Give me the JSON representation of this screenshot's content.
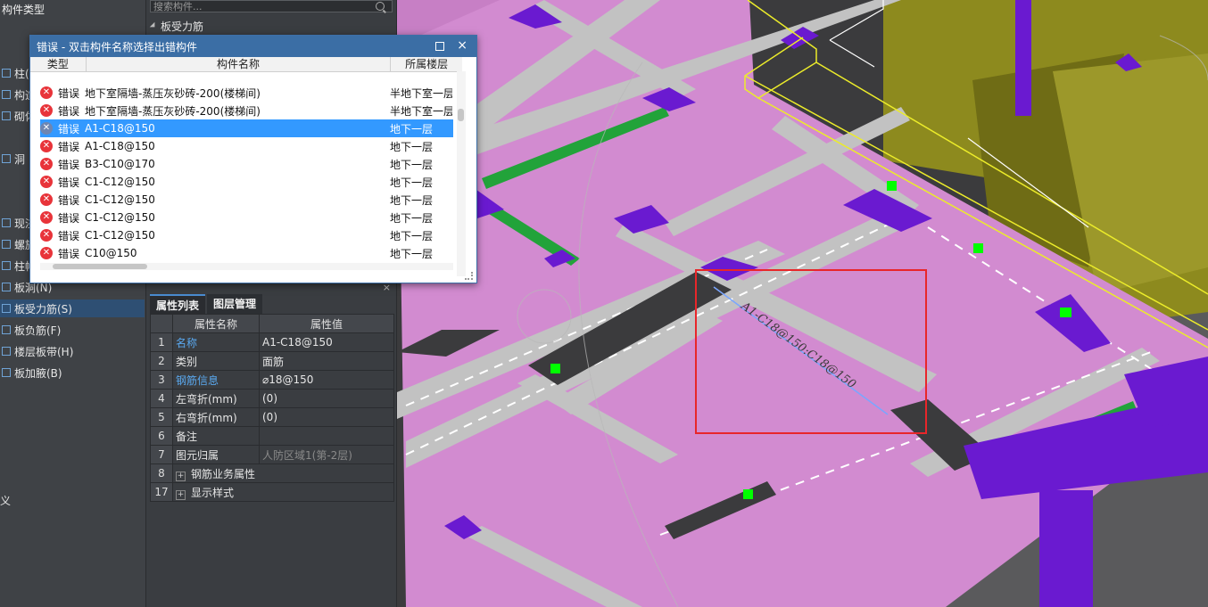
{
  "left_panel": {
    "title": "构件类型",
    "items": [
      {
        "label": "柱(",
        "selected": false
      },
      {
        "label": "构造",
        "selected": false
      },
      {
        "label": "砌体",
        "selected": false
      },
      {
        "label": "洞",
        "selected": false
      },
      {
        "label": "现浇",
        "selected": false
      },
      {
        "label": "螺旋",
        "selected": false
      },
      {
        "label": "柱帽",
        "selected": false
      },
      {
        "label": "板洞(N)",
        "selected": false
      },
      {
        "label": "板受力筋(S)",
        "selected": true
      },
      {
        "label": "板负筋(F)",
        "selected": false
      },
      {
        "label": "楼层板带(H)",
        "selected": false
      },
      {
        "label": "板加腋(B)",
        "selected": false
      }
    ],
    "bottom_char": "义"
  },
  "middle": {
    "search_placeholder": "搜索构件...",
    "tree_node": "板受力筋"
  },
  "properties": {
    "tabs": [
      "属性列表",
      "图层管理"
    ],
    "close": "×",
    "headers": [
      "属性名称",
      "属性值"
    ],
    "rows": [
      {
        "num": "1",
        "name": "名称",
        "value": "A1-C18@150",
        "link": true,
        "gray": false,
        "expand": false
      },
      {
        "num": "2",
        "name": "类别",
        "value": "面筋",
        "link": false,
        "gray": false,
        "expand": false
      },
      {
        "num": "3",
        "name": "钢筋信息",
        "value": "⌀18@150",
        "link": true,
        "gray": false,
        "expand": false
      },
      {
        "num": "4",
        "name": "左弯折(mm)",
        "value": "(0)",
        "link": false,
        "gray": false,
        "expand": false
      },
      {
        "num": "5",
        "name": "右弯折(mm)",
        "value": "(0)",
        "link": false,
        "gray": false,
        "expand": false
      },
      {
        "num": "6",
        "name": "备注",
        "value": "",
        "link": false,
        "gray": false,
        "expand": false
      },
      {
        "num": "7",
        "name": "图元归属",
        "value": "人防区域1(第-2层)",
        "link": false,
        "gray": true,
        "expand": false
      },
      {
        "num": "8",
        "name": "钢筋业务属性",
        "value": "",
        "link": false,
        "gray": false,
        "expand": true
      },
      {
        "num": "17",
        "name": "显示样式",
        "value": "",
        "link": false,
        "gray": false,
        "expand": true
      }
    ]
  },
  "error_dialog": {
    "title": "错误 - 双击构件名称选择出错构件",
    "columns": [
      "类型",
      "构件名称",
      "所属楼层"
    ],
    "rows": [
      {
        "type": "错误",
        "name": "地下室隔墙-蒸压灰砂砖-200(楼梯间)",
        "floor": "半地下室一层",
        "selected": false
      },
      {
        "type": "错误",
        "name": "地下室隔墙-蒸压灰砂砖-200(楼梯间)",
        "floor": "半地下室一层",
        "selected": false
      },
      {
        "type": "错误",
        "name": "A1-C18@150",
        "floor": "地下一层",
        "selected": true
      },
      {
        "type": "错误",
        "name": "A1-C18@150",
        "floor": "地下一层",
        "selected": false
      },
      {
        "type": "错误",
        "name": "B3-C10@170",
        "floor": "地下一层",
        "selected": false
      },
      {
        "type": "错误",
        "name": "C1-C12@150",
        "floor": "地下一层",
        "selected": false
      },
      {
        "type": "错误",
        "name": "C1-C12@150",
        "floor": "地下一层",
        "selected": false
      },
      {
        "type": "错误",
        "name": "C1-C12@150",
        "floor": "地下一层",
        "selected": false
      },
      {
        "type": "错误",
        "name": "C1-C12@150",
        "floor": "地下一层",
        "selected": false
      },
      {
        "type": "错误",
        "name": "C10@150",
        "floor": "地下一层",
        "selected": false
      }
    ]
  },
  "viewport": {
    "rebar_label": "A1-C18@150:C18@150",
    "colors": {
      "slab": "#d28bd0",
      "beam_gray": "#c2c2c2",
      "beam_dark": "#3b3b3d",
      "purple": "#6a1ad0",
      "green": "#22a33a",
      "yellow": "#ecec2a",
      "olive": "#8d8a1e",
      "highlight_box": "#e8262a",
      "rebar_line": "#7aa6ff"
    }
  }
}
